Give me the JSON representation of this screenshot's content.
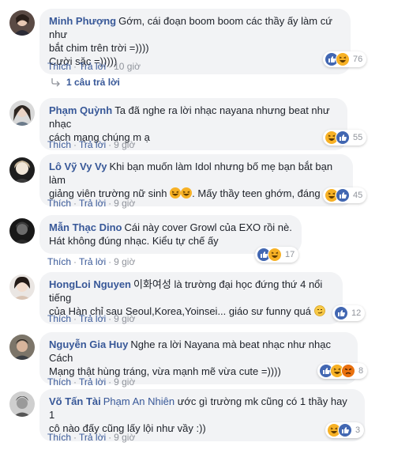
{
  "labels": {
    "like": "Thích",
    "reply": "Trả lời"
  },
  "reply_link": "1 câu trả lời",
  "comments": [
    {
      "author": "Minh Phượng",
      "lines": [
        "Gớm, cái đoạn boom boom các thầy ấy làm cứ như",
        "bắt chim trên trời =))))",
        "Cười sặc =)))))"
      ],
      "time": "10 giờ",
      "reactions": [
        "like",
        "haha"
      ],
      "count": "76"
    },
    {
      "author": "Phạm Quỳnh",
      "lines": [
        "Ta đã nghe ra lời nhạc nayana nhưng beat như nhạc",
        "cách mạng chúng m ạ"
      ],
      "time": "9 giờ",
      "reactions": [
        "haha",
        "like"
      ],
      "count": "55"
    },
    {
      "author": "Lô Vỹ Vy Vy",
      "lines": [
        "Khi bạn muốn làm Idol nhưng bố mẹ bạn bắt bạn làm",
        "giảng viên trường nữ sinh",
        "Mấy thầy teen ghớm, đáng eo"
      ],
      "time": "9 giờ",
      "reactions": [
        "haha",
        "like"
      ],
      "count": "45"
    },
    {
      "author": "Mẫn Thạc Dino",
      "lines": [
        "Cái này cover Growl của EXO rồi nè.",
        "Hát không đúng nhạc. Kiểu tự chế ấy"
      ],
      "time": "9 giờ",
      "reactions": [
        "like",
        "haha"
      ],
      "count": "17"
    },
    {
      "author": "HongLoi Nguyen",
      "lines": [
        "이화여성 là trường đại học đứng thứ 4 nổi tiếng",
        "của Hàn chỉ sau Seoul,Korea,Yoinsei... giáo sư funny quá"
      ],
      "time": "9 giờ",
      "reactions": [
        "like"
      ],
      "count": "12"
    },
    {
      "author": "Nguyễn Gia Huy",
      "lines": [
        "Nghe ra lời Nayana mà beat nhạc như nhạc Cách",
        "Mạng thật hùng tráng, vừa mạnh mẽ vừa cute =))))"
      ],
      "time": "9 giờ",
      "reactions": [
        "like",
        "haha",
        "angry"
      ],
      "count": "8"
    },
    {
      "author": "Võ Tấn Tài",
      "mention": "Phạm An Nhiên",
      "lines": [
        "ước gì trường mk cũng có 1 thầy hay 1",
        "cô nào đấy cũng lấy lội như vầy :))"
      ],
      "time": "9 giờ",
      "reactions": [
        "haha",
        "like"
      ],
      "count": "3"
    }
  ],
  "colors": {
    "link": "#385898",
    "meta": "#90949c",
    "bubble": "#f2f3f5",
    "like": "#4267b2",
    "haha": "#f7b125",
    "angry": "#e9710f"
  }
}
